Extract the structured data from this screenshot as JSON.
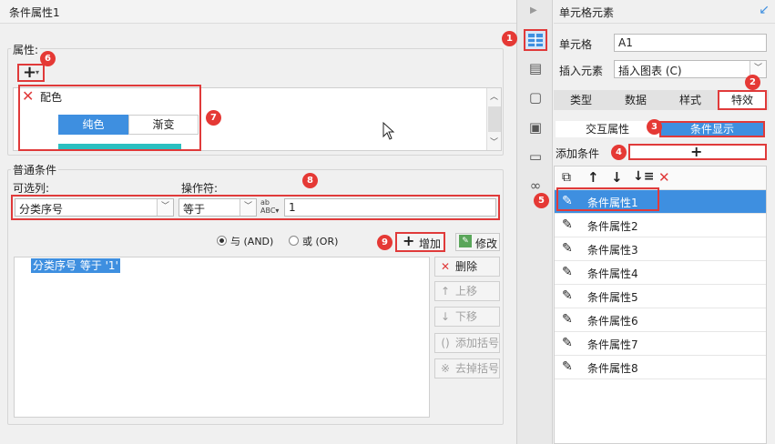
{
  "left_panel": {
    "title": "条件属性1",
    "properties_label": "属性:",
    "add_icon": "plus-icon",
    "property_item": {
      "label": "配色",
      "tabs": [
        "纯色",
        "渐变"
      ],
      "active_tab": "纯色",
      "swatch_color": "#2bbfc0"
    },
    "common_conditions_label": "普通条件",
    "column_label": "可选列:",
    "operator_label": "操作符:",
    "column_value": "分类序号",
    "operator_value": "等于",
    "value_input": "1",
    "logic_and": "与 (AND)",
    "logic_or": "或 (OR)",
    "add_button": "增加",
    "modify_button": "修改",
    "delete_button": "删除",
    "move_up_button": "上移",
    "move_down_button": "下移",
    "add_bracket_button": "添加括号",
    "remove_bracket_button": "去掉括号",
    "condition_text": "分类序号 等于 '1'"
  },
  "right_panel": {
    "title": "单元格元素",
    "cell_label": "单元格",
    "cell_value": "A1",
    "insert_label": "插入元素",
    "insert_value": "插入图表 (C)",
    "tabs": [
      "类型",
      "数据",
      "样式",
      "特效"
    ],
    "active_tab": "特效",
    "subtabs": [
      "交互属性",
      "条件显示"
    ],
    "active_subtab": "条件显示",
    "add_condition_label": "添加条件",
    "conditions": [
      "条件属性1",
      "条件属性2",
      "条件属性3",
      "条件属性4",
      "条件属性5",
      "条件属性6",
      "条件属性7",
      "条件属性8"
    ],
    "selected_condition": "条件属性1"
  },
  "badges": [
    "1",
    "2",
    "3",
    "4",
    "5",
    "6",
    "7",
    "8",
    "9"
  ],
  "colors": {
    "accent": "#3e8fe0",
    "highlight": "#e03a3a",
    "selection": "#3e8fe0"
  }
}
